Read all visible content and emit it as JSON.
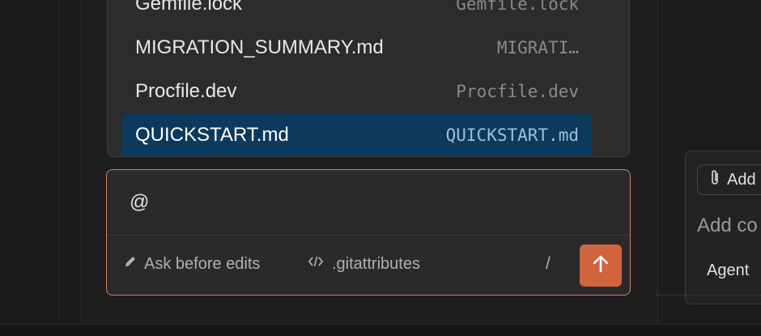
{
  "file_list": {
    "items": [
      {
        "name": "Gemfile.lock",
        "path": "Gemfile.lock"
      },
      {
        "name": "MIGRATION_SUMMARY.md",
        "path": "MIGRATI…"
      },
      {
        "name": "Procfile.dev",
        "path": "Procfile.dev"
      },
      {
        "name": "QUICKSTART.md",
        "path": "QUICKSTART.md"
      }
    ],
    "selected_index": 3
  },
  "composer": {
    "input_value": "@",
    "mode_label": "Ask before edits",
    "context_label": ".gitattributes",
    "slash_label": "/"
  },
  "side_panel": {
    "attach_label": "Add",
    "context_label": "Add co",
    "agent_label": "Agent"
  },
  "colors": {
    "accent": "#d1643d",
    "focus_border": "#d5805d",
    "selection": "#0b3a5c"
  },
  "icons": {
    "mode": "pencil-icon",
    "context": "code-icon",
    "send": "arrow-up-icon",
    "attach": "paperclip-icon"
  }
}
